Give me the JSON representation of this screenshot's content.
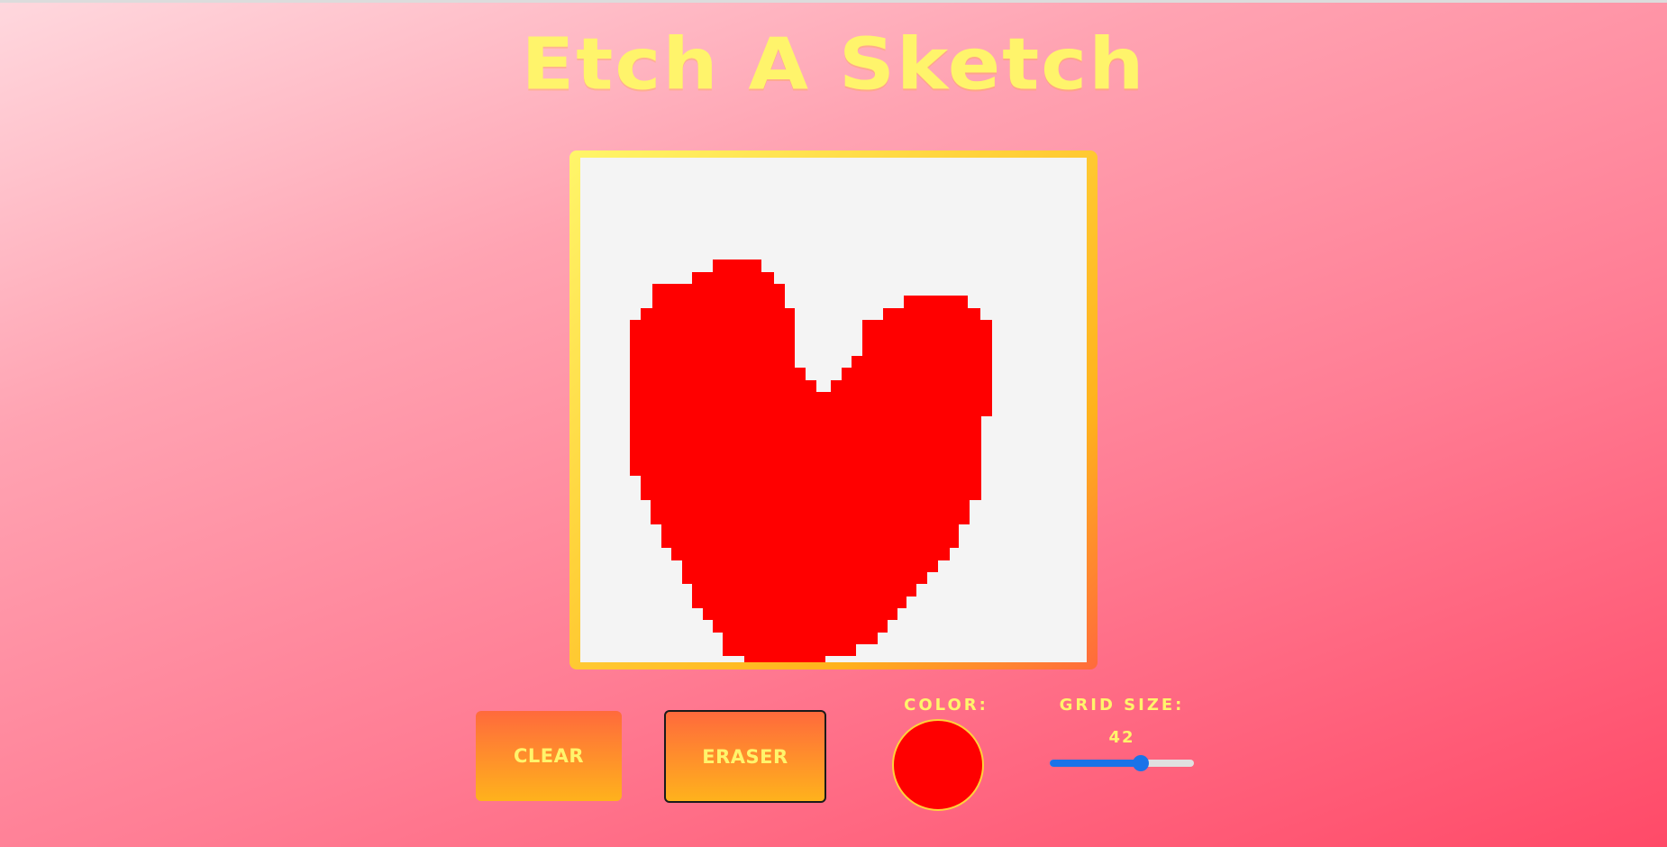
{
  "app": {
    "title": "Etch A Sketch"
  },
  "canvas": {
    "grid_size": 42,
    "background_color": "#f4f4f4",
    "paint_color": "#ff0000",
    "frame_colors": [
      "#fff66a",
      "#ffb21c",
      "#ff6a3c"
    ]
  },
  "controls": {
    "clear_label": "CLEAR",
    "eraser_label": "ERASER",
    "color_label": "COLOR:",
    "color_value": "#ff0000",
    "grid_size_label": "GRID SIZE:",
    "grid_size_value": "42",
    "grid_size_slider_fraction": 0.63
  },
  "colors": {
    "title": "#fff46b",
    "button_gradient_top": "#ff6a3c",
    "button_gradient_bottom": "#ffb21c",
    "slider_accent": "#1a73e8"
  }
}
